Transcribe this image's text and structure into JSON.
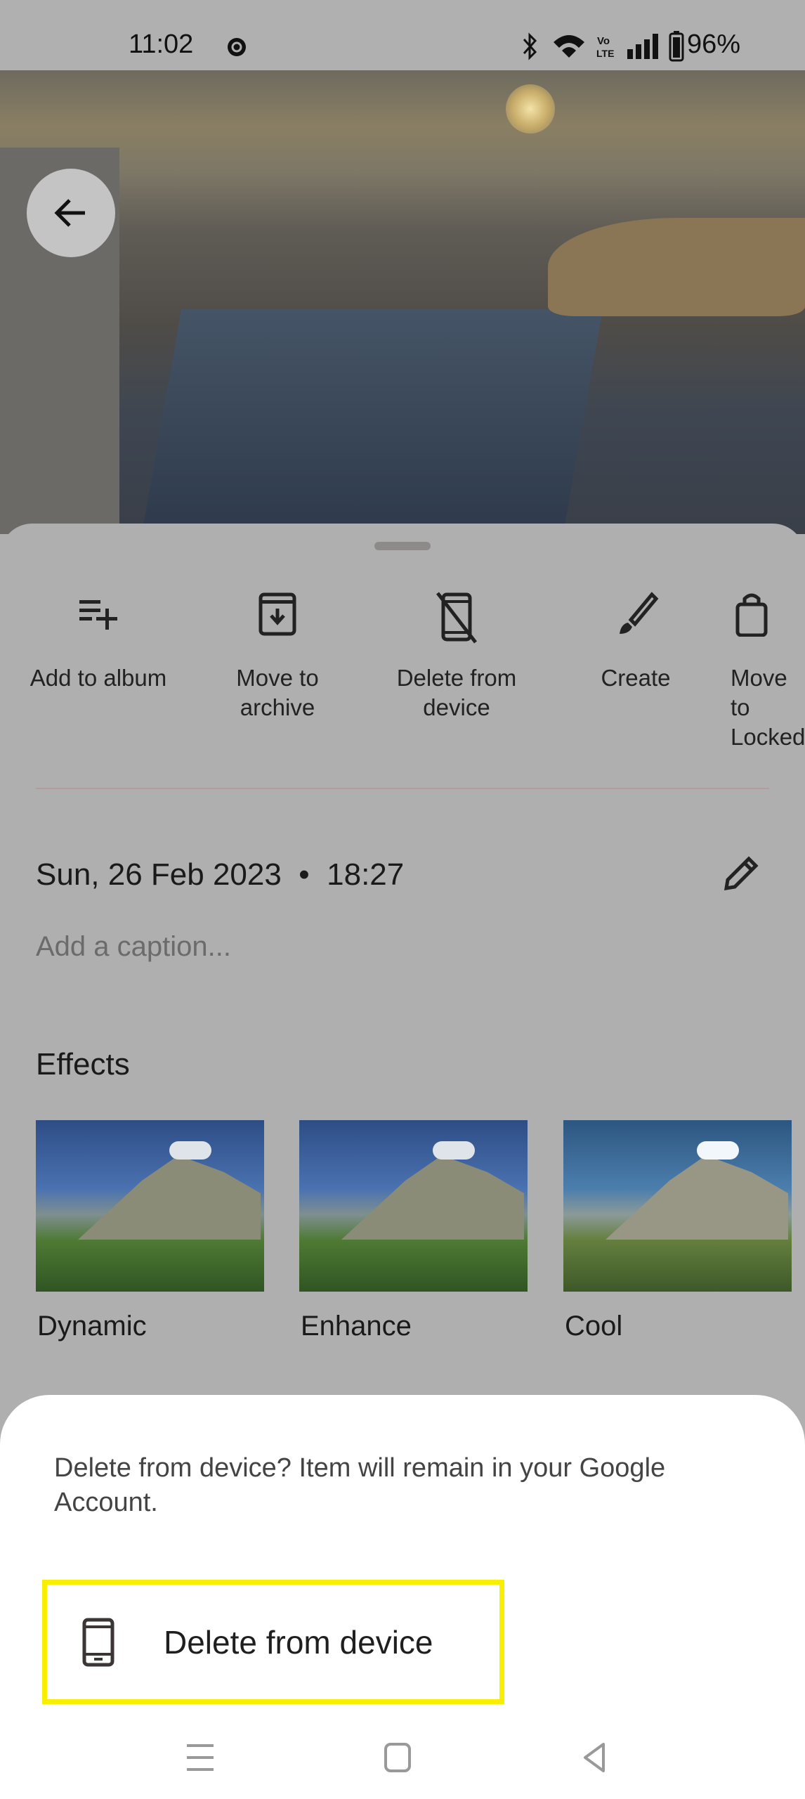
{
  "status_bar": {
    "time": "11:02",
    "battery": "96%",
    "icons": [
      "app-notification-icon",
      "bluetooth-icon",
      "wifi-icon",
      "volte-icon",
      "signal-icon",
      "battery-icon"
    ]
  },
  "photo": {
    "back_icon": "arrow-back-icon"
  },
  "actions": [
    {
      "label": "Add to album",
      "icon": "playlist-add-icon"
    },
    {
      "label": "Move to archive",
      "icon": "archive-icon"
    },
    {
      "label": "Delete from device",
      "icon": "mobile-off-icon"
    },
    {
      "label": "Create",
      "icon": "brush-icon"
    },
    {
      "label": "Move to Locked",
      "icon": "lock-folder-icon"
    }
  ],
  "details": {
    "date": "Sun, 26 Feb 2023  •  18:27",
    "caption_placeholder": "Add a caption...",
    "edit_icon": "pencil-icon"
  },
  "effects": {
    "title": "Effects",
    "items": [
      {
        "label": "Dynamic"
      },
      {
        "label": "Enhance"
      },
      {
        "label": "Cool"
      }
    ]
  },
  "dialog": {
    "message": "Delete from device? Item will remain in your Google Account.",
    "button_label": "Delete from device",
    "button_icon": "smartphone-icon",
    "highlight_color": "#f7ee00"
  },
  "nav": {
    "icons": [
      "recents-icon",
      "home-icon",
      "back-icon"
    ]
  }
}
